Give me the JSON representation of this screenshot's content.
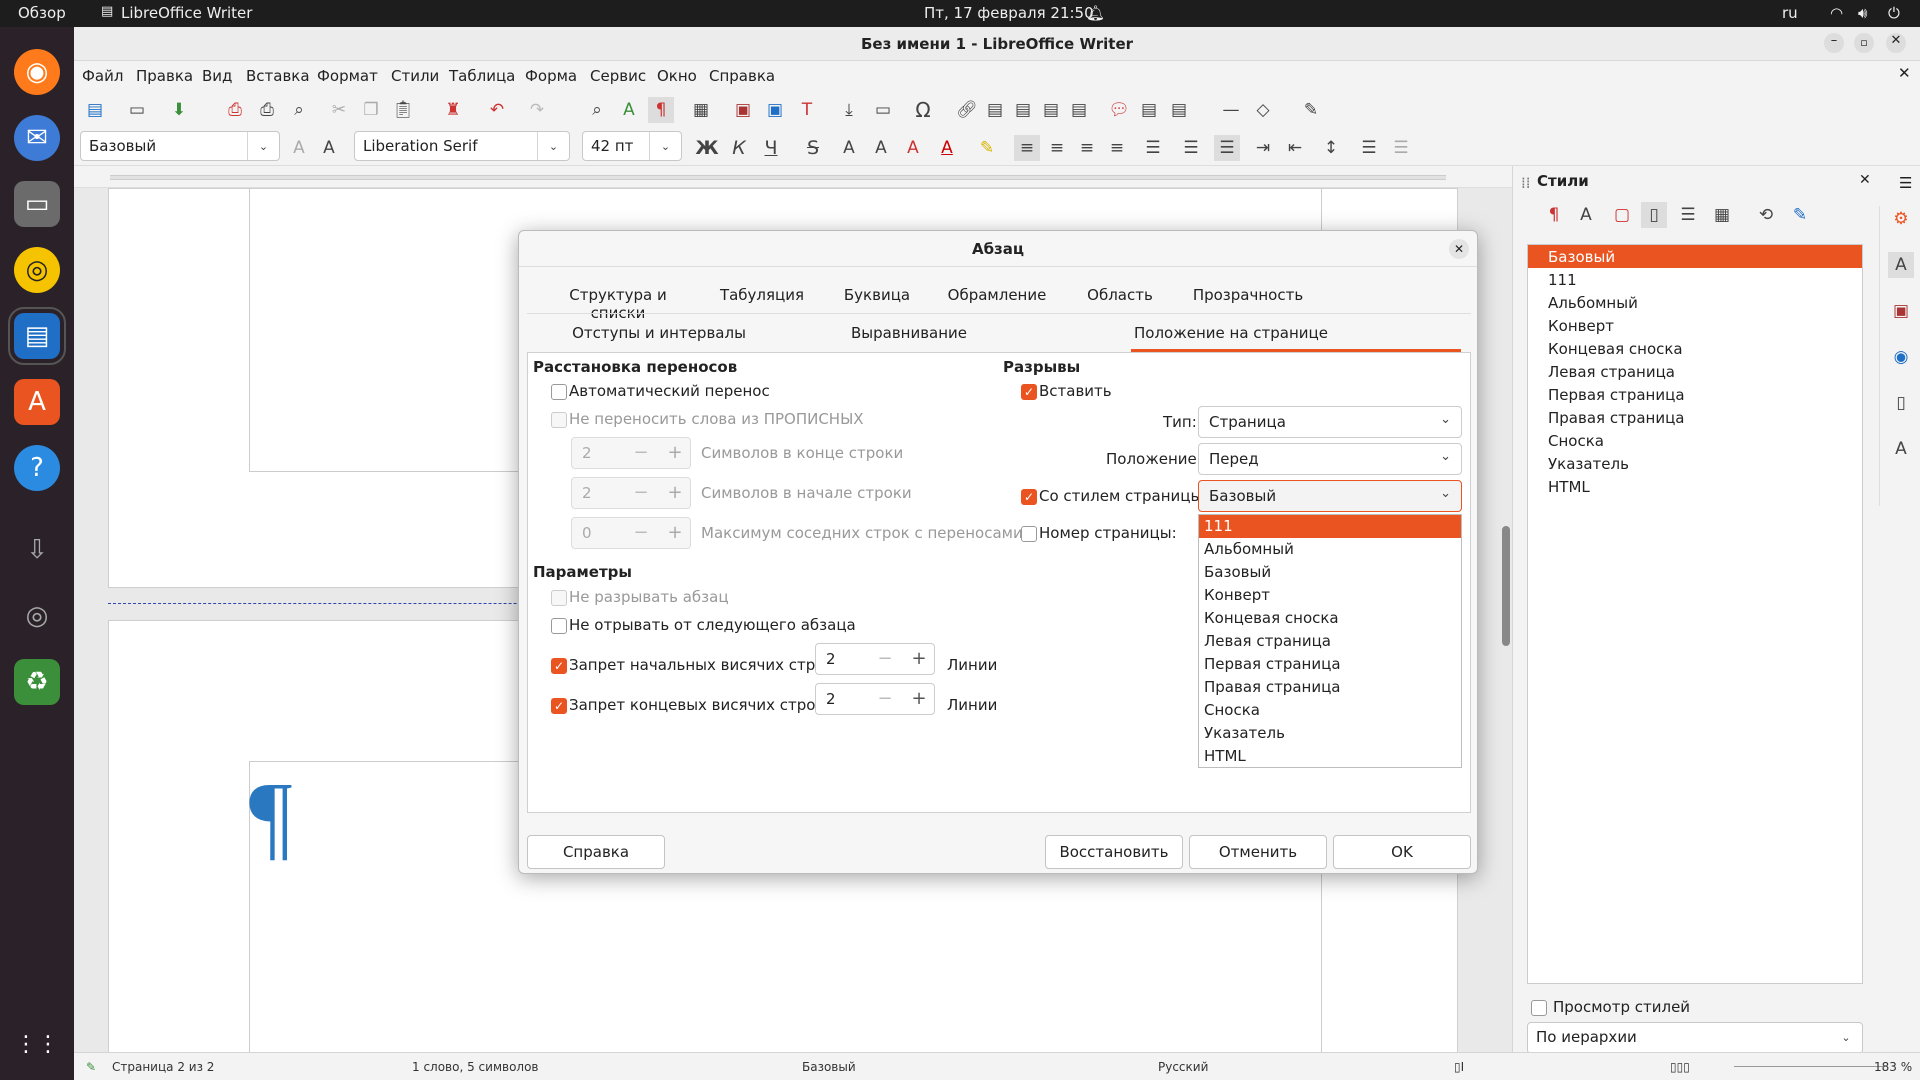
{
  "topbar": {
    "overview": "Обзор",
    "app": "LibreOffice Writer",
    "clock": "Пт, 17 февраля  21:50",
    "lang": "ru"
  },
  "window": {
    "title": "Без имени 1 - LibreOffice Writer"
  },
  "menu": [
    "Файл",
    "Правка",
    "Вид",
    "Вставка",
    "Формат",
    "Стили",
    "Таблица",
    "Форма",
    "Сервис",
    "Окно",
    "Справка"
  ],
  "toolbar": {
    "para_style": "Базовый",
    "font_name": "Liberation Serif",
    "font_size": "42 пт"
  },
  "sidebar": {
    "title": "Стили",
    "styles": [
      "Базовый",
      "111",
      "Альбомный",
      "Конверт",
      "Концевая сноска",
      "Левая страница",
      "Первая страница",
      "Правая страница",
      "Сноска",
      "Указатель",
      "HTML"
    ],
    "preview_label": "Просмотр стилей",
    "filter": "По иерархии"
  },
  "statusbar": {
    "page": "Страница 2 из 2",
    "words": "1 слово, 5 символов",
    "style": "Базовый",
    "lang": "Русский",
    "zoom": "183 %"
  },
  "dialog": {
    "title": "Абзац",
    "tabs_row1": [
      "Структура и списки",
      "Табуляция",
      "Буквица",
      "Обрамление",
      "Область",
      "Прозрачность"
    ],
    "tabs_row2": [
      "Отступы и интервалы",
      "Выравнивание",
      "Положение на странице"
    ],
    "hyphen": {
      "heading": "Расстановка переносов",
      "auto": "Автоматический перенос",
      "no_caps": "Не переносить слова из ПРОПИСНЫХ",
      "end_chars_value": "2",
      "end_chars_label": "Символов в конце строки",
      "start_chars_value": "2",
      "start_chars_label": "Символов в начале строки",
      "max_lines_value": "0",
      "max_lines_label": "Максимум соседних строк с переносами"
    },
    "options": {
      "heading": "Параметры",
      "no_split": "Не разрывать абзац",
      "keep_next": "Не отрывать от следующего абзаца",
      "orphan": "Запрет начальных висячих строк",
      "orphan_value": "2",
      "orphan_unit": "Линии",
      "widow": "Запрет концевых висячих строк",
      "widow_value": "2",
      "widow_unit": "Линии"
    },
    "breaks": {
      "heading": "Разрывы",
      "insert": "Вставить",
      "type_label": "Тип:",
      "type_value": "Страница",
      "position_label": "Положение:",
      "position_value": "Перед",
      "with_style": "Со стилем страницы:",
      "style_value": "Базовый",
      "page_number": "Номер страницы:"
    },
    "dropdown_options": [
      "111",
      "Альбомный",
      "Базовый",
      "Конверт",
      "Концевая сноска",
      "Левая страница",
      "Первая страница",
      "Правая страница",
      "Сноска",
      "Указатель",
      "HTML"
    ],
    "buttons": {
      "help": "Справка",
      "reset": "Восстановить",
      "cancel": "Отменить",
      "ok": "OK"
    }
  },
  "colors": {
    "accent": "#e95420",
    "pilcrow": "#2a78c0"
  }
}
